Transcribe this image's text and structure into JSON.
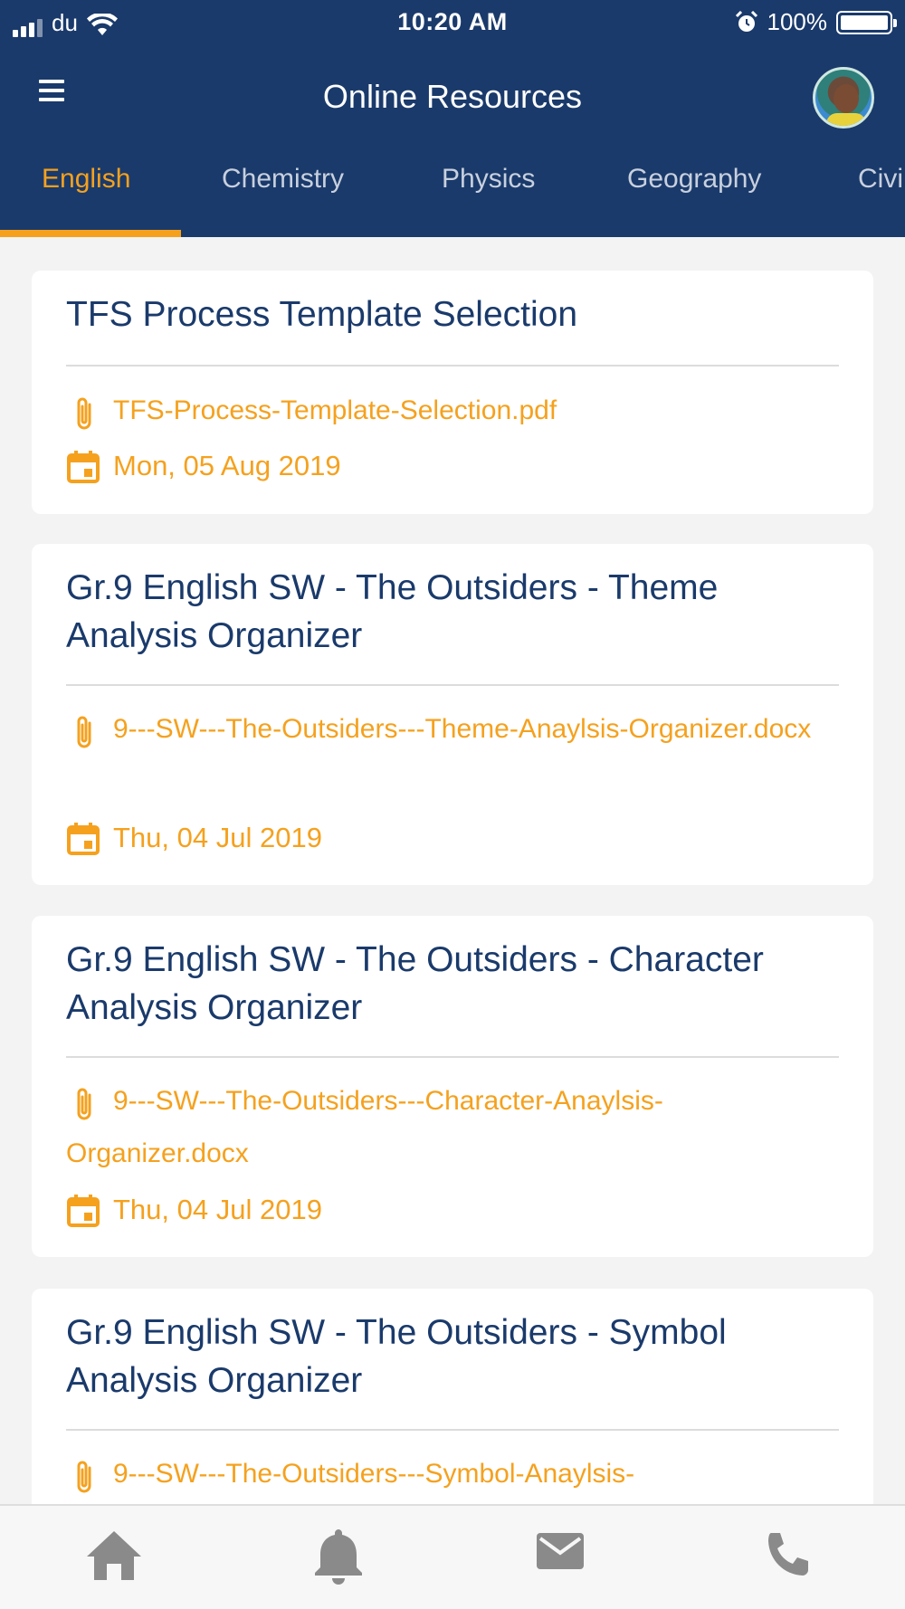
{
  "status_bar": {
    "carrier": "du",
    "time": "10:20 AM",
    "battery": "100%"
  },
  "header": {
    "title": "Online Resources"
  },
  "tabs": [
    {
      "label": "English",
      "active": true
    },
    {
      "label": "Chemistry",
      "active": false
    },
    {
      "label": "Physics",
      "active": false
    },
    {
      "label": "Geography",
      "active": false
    },
    {
      "label": "Civi",
      "active": false
    }
  ],
  "resources": [
    {
      "title": "TFS Process Template Selection",
      "file": "TFS-Process-Template-Selection.pdf",
      "date": "Mon, 05 Aug 2019"
    },
    {
      "title": "Gr.9 English SW - The Outsiders - Theme Analysis Organizer",
      "file": "9---SW---The-Outsiders---Theme-Anaylsis-Organizer.docx",
      "date": "Thu, 04 Jul 2019"
    },
    {
      "title": "Gr.9 English SW - The Outsiders - Character Analysis Organizer",
      "file": "9---SW---The-Outsiders---Character-Anaylsis-Organizer.docx",
      "date": "Thu, 04 Jul 2019"
    },
    {
      "title": "Gr.9 English SW - The Outsiders - Symbol Analysis Organizer",
      "file": "9---SW---The-Outsiders---Symbol-Anaylsis-",
      "date": ""
    }
  ],
  "bottom_nav": {
    "icons": [
      "home-icon",
      "bell-icon",
      "mail-icon",
      "phone-icon"
    ]
  },
  "colors": {
    "primary": "#1a3a6b",
    "accent": "#f5a11e",
    "background": "#f3f3f3"
  }
}
